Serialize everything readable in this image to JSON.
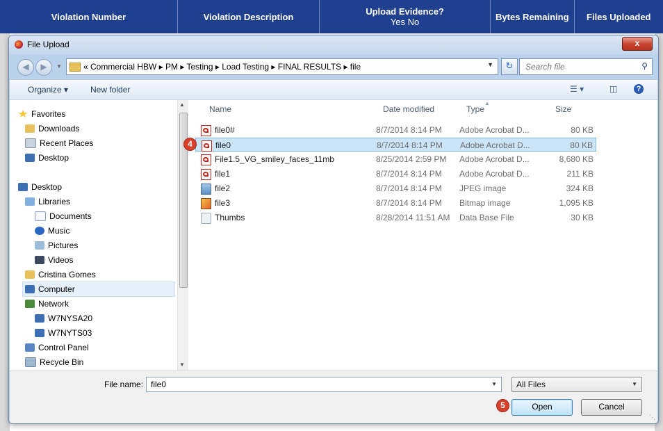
{
  "background_table": {
    "headers": [
      {
        "label": "Violation Number",
        "sub": ""
      },
      {
        "label": "Violation Description",
        "sub": ""
      },
      {
        "label": "Upload Evidence?",
        "sub": "Yes No"
      },
      {
        "label": "Bytes Remaining",
        "sub": ""
      },
      {
        "label": "Files Uploaded",
        "sub": ""
      }
    ]
  },
  "dialog": {
    "title": "File Upload",
    "close_label": "x",
    "breadcrumb": "« Commercial HBW ▸ PM ▸ Testing ▸ Load Testing ▸ FINAL RESULTS ▸ file",
    "search_placeholder": "Search file",
    "commands": {
      "organize": "Organize ▾",
      "new_folder": "New folder"
    },
    "nav": [
      {
        "label": "Favorites",
        "icon": "star-icon"
      },
      {
        "label": "Downloads",
        "icon": "downloads-folder-icon"
      },
      {
        "label": "Recent Places",
        "icon": "recent-places-icon"
      },
      {
        "label": "Desktop",
        "icon": "desktop-icon"
      },
      {
        "label": "Desktop",
        "icon": "desktop-icon"
      },
      {
        "label": "Libraries",
        "icon": "libraries-icon"
      },
      {
        "label": "Documents",
        "icon": "documents-icon"
      },
      {
        "label": "Music",
        "icon": "music-icon"
      },
      {
        "label": "Pictures",
        "icon": "pictures-icon"
      },
      {
        "label": "Videos",
        "icon": "videos-icon"
      },
      {
        "label": "Cristina Gomes",
        "icon": "user-folder-icon"
      },
      {
        "label": "Computer",
        "icon": "computer-icon"
      },
      {
        "label": "Network",
        "icon": "network-icon"
      },
      {
        "label": "W7NYSA20",
        "icon": "computer-icon"
      },
      {
        "label": "W7NYTS03",
        "icon": "computer-icon"
      },
      {
        "label": "Control Panel",
        "icon": "control-panel-icon"
      },
      {
        "label": "Recycle Bin",
        "icon": "recycle-bin-icon"
      }
    ],
    "columns": {
      "name": "Name",
      "date": "Date modified",
      "type": "Type",
      "size": "Size"
    },
    "files": [
      {
        "name": "file0#",
        "date": "8/7/2014 8:14 PM",
        "type": "Adobe Acrobat D...",
        "size": "80 KB",
        "icon": "pdf-icon"
      },
      {
        "name": "file0",
        "date": "8/7/2014 8:14 PM",
        "type": "Adobe Acrobat D...",
        "size": "80 KB",
        "icon": "pdf-icon"
      },
      {
        "name": "File1.5_VG_smiley_faces_11mb",
        "date": "8/25/2014 2:59 PM",
        "type": "Adobe Acrobat D...",
        "size": "8,680 KB",
        "icon": "pdf-icon"
      },
      {
        "name": "file1",
        "date": "8/7/2014 8:14 PM",
        "type": "Adobe Acrobat D...",
        "size": "211 KB",
        "icon": "pdf-icon"
      },
      {
        "name": "file2",
        "date": "8/7/2014 8:14 PM",
        "type": "JPEG image",
        "size": "324 KB",
        "icon": "jpeg-icon"
      },
      {
        "name": "file3",
        "date": "8/7/2014 8:14 PM",
        "type": "Bitmap image",
        "size": "1,095 KB",
        "icon": "bitmap-icon"
      },
      {
        "name": "Thumbs",
        "date": "8/28/2014 11:51 AM",
        "type": "Data Base File",
        "size": "30 KB",
        "icon": "database-file-icon"
      }
    ],
    "file_name_label": "File name:",
    "file_name_value": "file0",
    "file_type_value": "All Files",
    "open_label": "Open",
    "cancel_label": "Cancel",
    "step_badges": {
      "file_row": "4",
      "open_button": "5"
    }
  }
}
